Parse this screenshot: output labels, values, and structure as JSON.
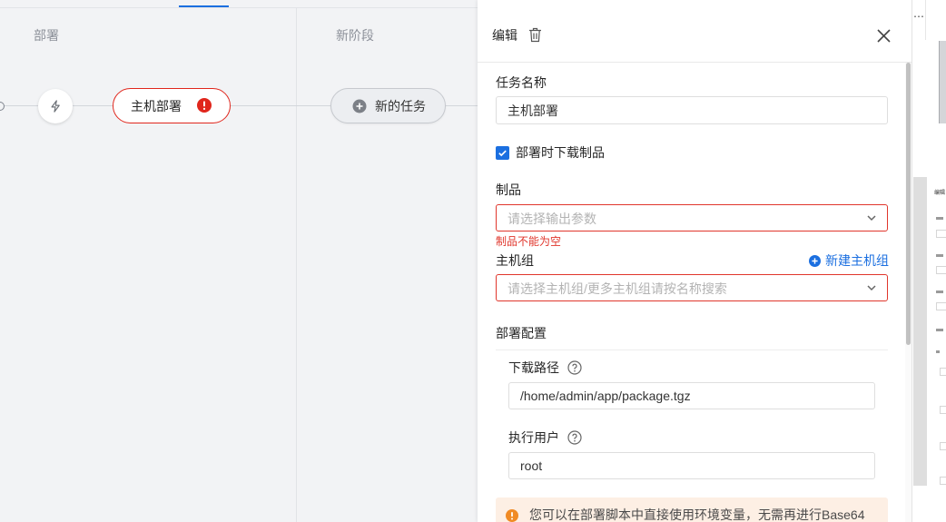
{
  "canvas": {
    "stages": [
      {
        "title": "部署"
      },
      {
        "title": "新阶段"
      }
    ],
    "trigger": {
      "icon": "lightning-icon"
    },
    "task_node": {
      "label": "主机部署",
      "status_icon": "error-exclamation-icon"
    },
    "new_task": {
      "label": "新的任务",
      "icon": "plus-circle-icon"
    }
  },
  "panel": {
    "title": "编辑",
    "delete_icon": "trash-icon",
    "close_icon": "close-icon",
    "task_name": {
      "label": "任务名称",
      "value": "主机部署"
    },
    "download_artifact": {
      "label": "部署时下载制品",
      "checked": true
    },
    "artifact": {
      "label": "制品",
      "placeholder": "请选择输出参数",
      "error": "制品不能为空",
      "icon": "chevron-down-icon"
    },
    "host_group": {
      "label": "主机组",
      "placeholder": "请选择主机组/更多主机组请按名称搜索",
      "create_label": "新建主机组",
      "create_icon": "plus-circle-icon",
      "icon": "chevron-down-icon"
    },
    "deploy_config": {
      "label": "部署配置",
      "download_path": {
        "label": "下载路径",
        "value": "/home/admin/app/package.tgz",
        "help_icon": "question-circle-icon"
      },
      "exec_user": {
        "label": "执行用户",
        "value": "root",
        "help_icon": "question-circle-icon"
      }
    },
    "notice": {
      "icon": "warning-icon",
      "text": "您可以在部署脚本中直接使用环境变量，无需再进行Base64"
    }
  },
  "background_window": {
    "mini_title": "编辑",
    "menu_icon": "more-icon"
  },
  "colors": {
    "accent": "#1b6fe0",
    "error": "#e0362c",
    "warning": "#f08a24",
    "notice_bg": "#fdefe4",
    "canvas_bg": "#f2f3f5"
  }
}
